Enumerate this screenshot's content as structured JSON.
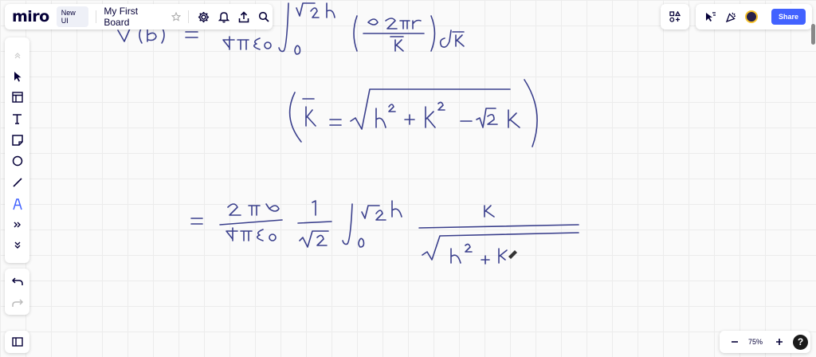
{
  "app": {
    "logo": "miro",
    "badge": "New UI",
    "board_title": "My First Board",
    "share_label": "Share",
    "accent_color": "#4262ff"
  },
  "zoom": {
    "level": "75%"
  },
  "help": {
    "label": "?"
  },
  "left_toolbar": {
    "tools": [
      "select-icon",
      "templates-icon",
      "text-icon",
      "sticky-note-icon",
      "shape-icon",
      "pen-line-icon",
      "pen-icon",
      "more-tools-icon",
      "collapse-icon"
    ]
  },
  "top_icons": [
    "settings-icon",
    "bell-icon",
    "export-icon",
    "search-icon"
  ]
}
